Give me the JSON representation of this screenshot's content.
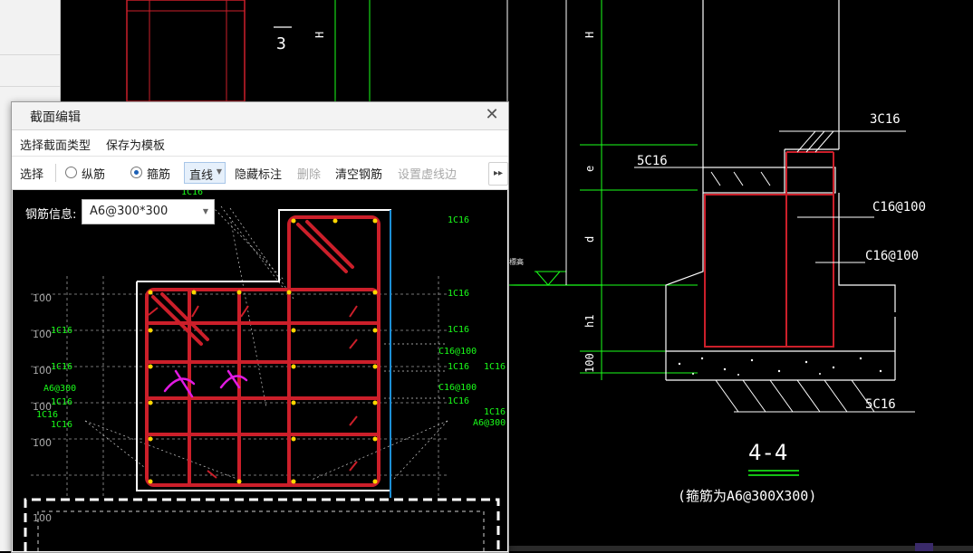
{
  "colors": {
    "background": "#000000",
    "rebar": "#cc1f2a",
    "dim_green": "#1aff1a",
    "accent_blue": "#1c8fd6",
    "dialog_bg": "#ffffff"
  },
  "drawing": {
    "top_labels": {
      "fraction": "3",
      "h_mark": "H"
    },
    "right_dims": {
      "h": "H",
      "e": "e",
      "d": "d",
      "h1": "h1",
      "100": "100"
    },
    "rebar_labels": {
      "top": "3C16",
      "left_top": "5C16",
      "stirrup1": "C16@100",
      "stirrup2": "C16@100",
      "bottom": "5C16"
    },
    "section_title": "4-4",
    "section_note": "(箍筋为A6@300X300)"
  },
  "dialog": {
    "title": "截面编辑",
    "menu": {
      "select_type": "选择截面类型",
      "save_template": "保存为模板"
    },
    "toolbar": {
      "select": "选择",
      "longitudinal": "纵筋",
      "stirrup": "箍筋",
      "line": "直线",
      "hide_label": "隐藏标注",
      "delete": "删除",
      "clear_rebar": "清空钢筋",
      "set_dashed": "设置虚线边",
      "more": "▸▸"
    },
    "rebar_info_label": "钢筋信息:",
    "rebar_info_value": "A6@300*300",
    "canvas_labels": {
      "c1": "1C16",
      "c2": "1C16",
      "c3": "1C16",
      "c4": "C16@100",
      "c5": "1C16",
      "c6": "1C16",
      "c7": "C16@100",
      "c8": "1C16",
      "c9": "1C16",
      "c10": "A6@300",
      "l1": "1C16",
      "l2": "1C16",
      "l3": "A6@300",
      "l4": "1C16",
      "l5": "1C16",
      "l6": "1C16",
      "l7": "1C16",
      "g1": "100",
      "g2": "100",
      "g3": "100",
      "g4": "100",
      "g5": "100",
      "g6": "100"
    }
  }
}
